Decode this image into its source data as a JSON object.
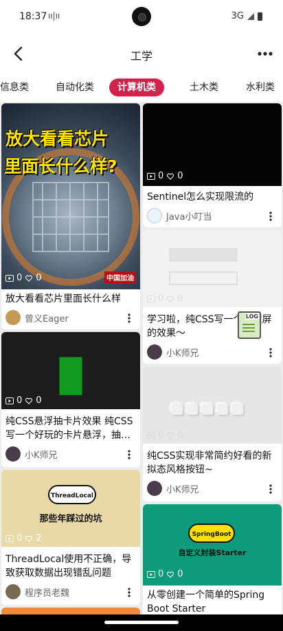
{
  "status": {
    "time": "18:37",
    "extra": "ıı|ıı",
    "network": "3G"
  },
  "header": {
    "title": "工学"
  },
  "tabs": [
    "信息类",
    "自动化类",
    "计算机类",
    "土木类",
    "水利类"
  ],
  "active_tab": "计算机类",
  "cards": [
    {
      "views": "0",
      "likes": "0",
      "title": "放大看看芯片里面长什么样",
      "author": "曾义Eager",
      "thumb_text_1": "放大看看芯片",
      "thumb_text_2": "里面长什么样?",
      "thumb_watermark": "中国加油"
    },
    {
      "views": "0",
      "likes": "0",
      "title": "Sentinel怎么实现限流的",
      "author": "Java小叮当"
    },
    {
      "views": "0",
      "likes": "0",
      "title": "学习啦，纯CSS写一个骨架屏的效果～",
      "author": "小K师兄",
      "badge": "LOG"
    },
    {
      "views": "0",
      "likes": "0",
      "title": "纯CSS悬浮抽卡片效果 纯CSS写一个好玩的卡片悬浮，抽…",
      "author": "小K师兄"
    },
    {
      "views": "0",
      "likes": "0",
      "title": "纯CSS实现非常简约好看的新拟态风格按钮~",
      "author": "小K师兄"
    },
    {
      "views": "0",
      "likes": "2",
      "title": "ThreadLocal使用不正确，导致获取数据出现错乱问题",
      "author": "程序员老魏",
      "thumb_bubble": "ThreadLocal",
      "thumb_caption": "那些年踩过的坑"
    },
    {
      "views": "0",
      "likes": "0",
      "title": "从零创建一个简单的Spring Boot Starter",
      "author": "",
      "thumb_bubble": "SpringBoot",
      "thumb_caption": "自定义封装Starter"
    }
  ],
  "colors": {
    "accent": "#d4204a",
    "background": "#ececec"
  }
}
